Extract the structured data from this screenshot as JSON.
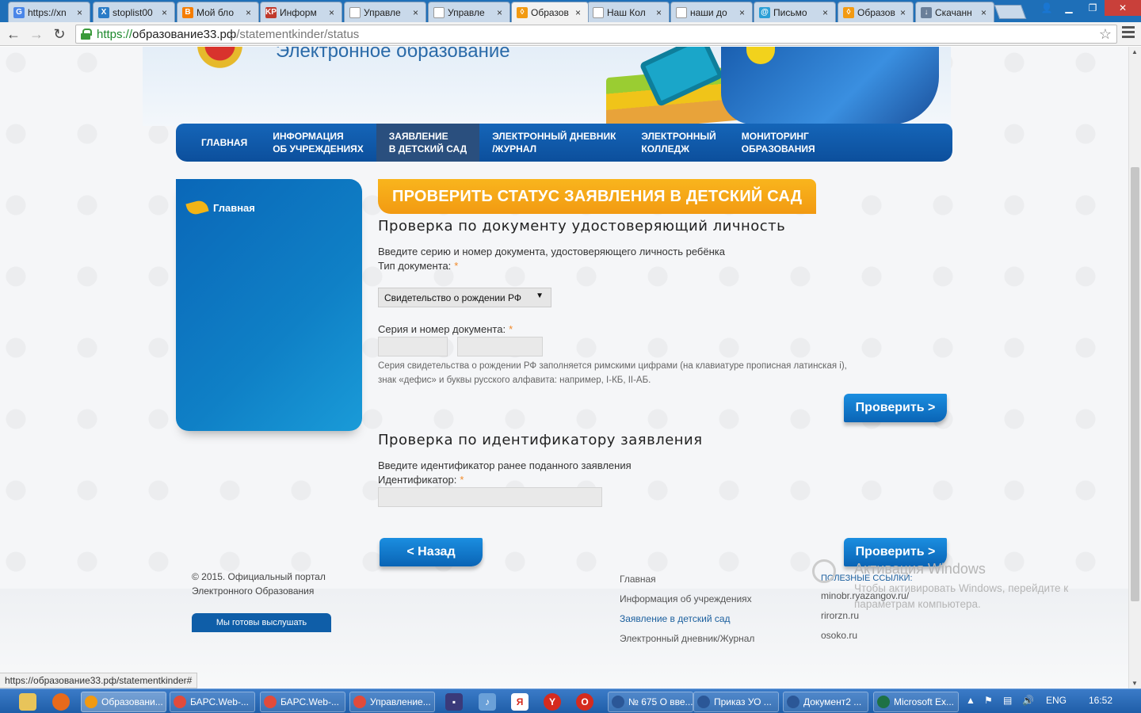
{
  "browser": {
    "tabs": [
      {
        "title": "https://xn",
        "favicon": "G",
        "color": "#4a86e8"
      },
      {
        "title": "stoplist00",
        "favicon": "X",
        "color": "#2a7cc7"
      },
      {
        "title": "Мой бло",
        "favicon": "B",
        "color": "#f57d00"
      },
      {
        "title": "Информ",
        "favicon": "KP",
        "color": "#c0392b"
      },
      {
        "title": "Управле",
        "favicon": "",
        "color": "#ffffff"
      },
      {
        "title": "Управле",
        "favicon": "",
        "color": "#ffffff"
      },
      {
        "title": "Образов",
        "favicon": "◊",
        "color": "#f29a12",
        "active": true
      },
      {
        "title": "Наш Кол",
        "favicon": "",
        "color": "#ffffff"
      },
      {
        "title": "наши до",
        "favicon": "",
        "color": "#ffffff"
      },
      {
        "title": "Письмо",
        "favicon": "@",
        "color": "#2a9fd6"
      },
      {
        "title": "Образов",
        "favicon": "◊",
        "color": "#f29a12"
      },
      {
        "title": "Скачанн",
        "favicon": "↓",
        "color": "#6a7f99"
      }
    ],
    "url": {
      "scheme": "https://",
      "host": "образование33.рф",
      "path": "/statementkinder/status"
    },
    "status_url": "https://образование33.рф/statementkinder#"
  },
  "site": {
    "title": "Электронное образование",
    "nav": [
      {
        "label": "ГЛАВНАЯ"
      },
      {
        "label": "ИНФОРМАЦИЯ\nОБ УЧРЕЖДЕНИЯХ"
      },
      {
        "label": "ЗАЯВЛЕНИЕ\nВ ДЕТСКИЙ САД",
        "active": true
      },
      {
        "label": "ЭЛЕКТРОННЫЙ ДНЕВНИК\n/ЖУРНАЛ"
      },
      {
        "label": "ЭЛЕКТРОННЫЙ\nКОЛЛЕДЖ"
      },
      {
        "label": "МОНИТОРИНГ\nОБРАЗОВАНИЯ"
      }
    ],
    "sidebar_item": "Главная"
  },
  "form": {
    "banner": "ПРОВЕРИТЬ СТАТУС ЗАЯВЛЕНИЯ В ДЕТСКИЙ САД",
    "section1_title": "Проверка по документу удостоверяющий личность",
    "section1_intro": "Введите серию и номер документа, удостоверяющего личность ребёнка",
    "doc_type_label": "Тип документа:",
    "doc_type_value": "Свидетельство о рождении РФ",
    "doc_number_label": "Серия и номер документа:",
    "required_mark": "*",
    "hint_line1": "Серия свидетельства о рождении РФ заполняется римскими цифрами (на клавиатуре прописная латинская i),",
    "hint_line2": "знак «дефис» и буквы русского алфавита: например, I-КБ, II-АБ.",
    "check_button": "Проверить >",
    "section2_title": "Проверка по идентификатору заявления",
    "section2_intro": "Введите идентификатор ранее поданного заявления",
    "id_label": "Идентификатор:",
    "back_button": "< Назад",
    "check_button2": "Проверить >"
  },
  "footer": {
    "copyright": "© 2015. Официальный портал\nЭлектронного Образования",
    "feedback_button": "Мы готовы выслушать",
    "nav": [
      "Главная",
      "Информация об учреждениях",
      "Заявление в детский сад",
      "Электронный дневник/Журнал"
    ],
    "links_header": "ПОЛЕЗНЫЕ ССЫЛКИ:",
    "links": [
      "minobr.ryazangov.ru/",
      "rirorzn.ru",
      "osoko.ru"
    ]
  },
  "watermark": {
    "title": "Активация Windows",
    "text": "Чтобы активировать Windows, перейдите к параметрам компьютера."
  },
  "taskbar": {
    "tasks": [
      {
        "label": "Образовани...",
        "color": "#f29a12",
        "active": true
      },
      {
        "label": "БАРС.Web-...",
        "color": "#e14b3b"
      },
      {
        "label": "БАРС.Web-...",
        "color": "#e14b3b"
      },
      {
        "label": "Управление...",
        "color": "#e14b3b"
      },
      {
        "label": "№ 675 О вве...",
        "color": "#2b5797"
      },
      {
        "label": "Приказ УО ...",
        "color": "#2b5797"
      },
      {
        "label": "Документ2 ...",
        "color": "#2b5797"
      },
      {
        "label": "Microsoft Ex...",
        "color": "#1e7145"
      }
    ],
    "lang": "ENG",
    "time": "16:52"
  }
}
